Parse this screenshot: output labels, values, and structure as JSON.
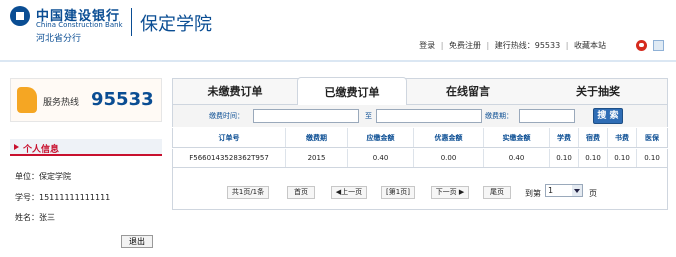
{
  "header": {
    "bank_name_cn": "中国建设银行",
    "bank_name_en": "China Construction Bank",
    "branch": "河北省分行",
    "org_title": "保定学院",
    "links": {
      "login": "登录",
      "register": "免费注册",
      "hotline": "建行热线：95533",
      "bookmark": "收藏本站",
      "separator": "|"
    }
  },
  "sidebar": {
    "hotline_label": "服务热线",
    "hotline_number": "95533",
    "info_title": "个人信息",
    "unit": "单位：保定学院",
    "student_id": "学号：15111111111111",
    "name": "姓名：张三",
    "logout": "退出"
  },
  "tabs": [
    {
      "label": "未缴费订单",
      "active": false
    },
    {
      "label": "已缴费订单",
      "active": true
    },
    {
      "label": "在线留言",
      "active": false
    },
    {
      "label": "关于抽奖",
      "active": false
    }
  ],
  "search": {
    "pay_time_label": "缴费时间：",
    "to_label": "至",
    "pay_period_label": "缴费期：",
    "start_value": "",
    "end_value": "",
    "period_value": "",
    "button": "搜 索"
  },
  "table": {
    "columns": [
      "订单号",
      "缴费期",
      "应缴金额",
      "优惠金额",
      "实缴金额",
      "学费",
      "宿费",
      "书费",
      "医保"
    ],
    "rows": [
      [
        "F5660143528362T957",
        "2015",
        "0.40",
        "0.00",
        "0.40",
        "0.10",
        "0.10",
        "0.10",
        "0.10"
      ]
    ]
  },
  "pagination": {
    "summary": "共1页/1条",
    "first": "首页",
    "prev": "◀上一页",
    "current": "[第1页]",
    "next": "下一页 ▶",
    "last": "尾页",
    "goto_label": "到第",
    "page_value": "1",
    "page_suffix": "页"
  },
  "colors": {
    "brand_blue": "#0a4d93",
    "accent_red": "#c8102e",
    "search_button": "#2f6db5"
  }
}
